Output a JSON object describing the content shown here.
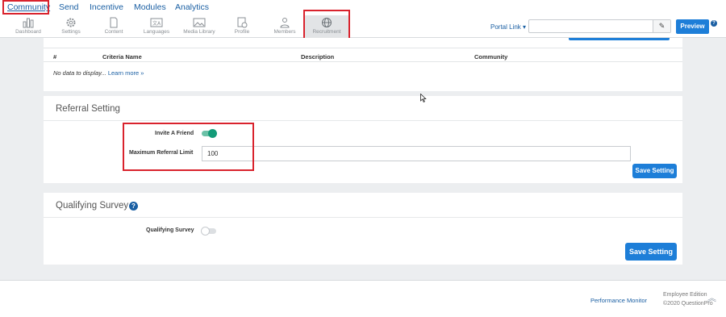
{
  "topnav": {
    "items": [
      {
        "label": "Community",
        "active": true
      },
      {
        "label": "Send"
      },
      {
        "label": "Incentive"
      },
      {
        "label": "Modules"
      },
      {
        "label": "Analytics"
      }
    ]
  },
  "iconbar": {
    "items": [
      {
        "label": "Dashboard",
        "icon": "dashboard-icon"
      },
      {
        "label": "Settings",
        "icon": "gear-icon"
      },
      {
        "label": "Content",
        "icon": "document-icon"
      },
      {
        "label": "Languages",
        "icon": "language-icon"
      },
      {
        "label": "Media Library",
        "icon": "image-icon"
      },
      {
        "label": "Profile",
        "icon": "profile-icon"
      },
      {
        "label": "Members",
        "icon": "members-icon"
      },
      {
        "label": "Recruitment",
        "icon": "globe-icon",
        "selected": true
      }
    ]
  },
  "header": {
    "portal_link_label": "Portal Link",
    "portal_link_value": "",
    "preview_label": "Preview",
    "help_glyph": "?"
  },
  "criteria_table": {
    "columns": [
      "#",
      "Criteria Name",
      "Description",
      "Community"
    ],
    "empty_text": "No data to display...",
    "learn_more": "Learn more »"
  },
  "referral": {
    "title": "Referral Setting",
    "invite_label": "Invite A Friend",
    "invite_enabled": true,
    "max_label": "Maximum Referral Limit",
    "max_value": "100",
    "save_label": "Save Setting"
  },
  "qualifying": {
    "title": "Qualifying Survey",
    "help_glyph": "?",
    "survey_label": "Qualifying Survey",
    "survey_enabled": false,
    "save_label": "Save Setting"
  },
  "footer": {
    "performance_monitor": "Performance Monitor",
    "edition": "Employee Edition",
    "copyright": "©2020 QuestionPro"
  },
  "colors": {
    "accent": "#1d7ed8",
    "highlight_border": "#d9232d",
    "toggle_on": "#139b78"
  }
}
